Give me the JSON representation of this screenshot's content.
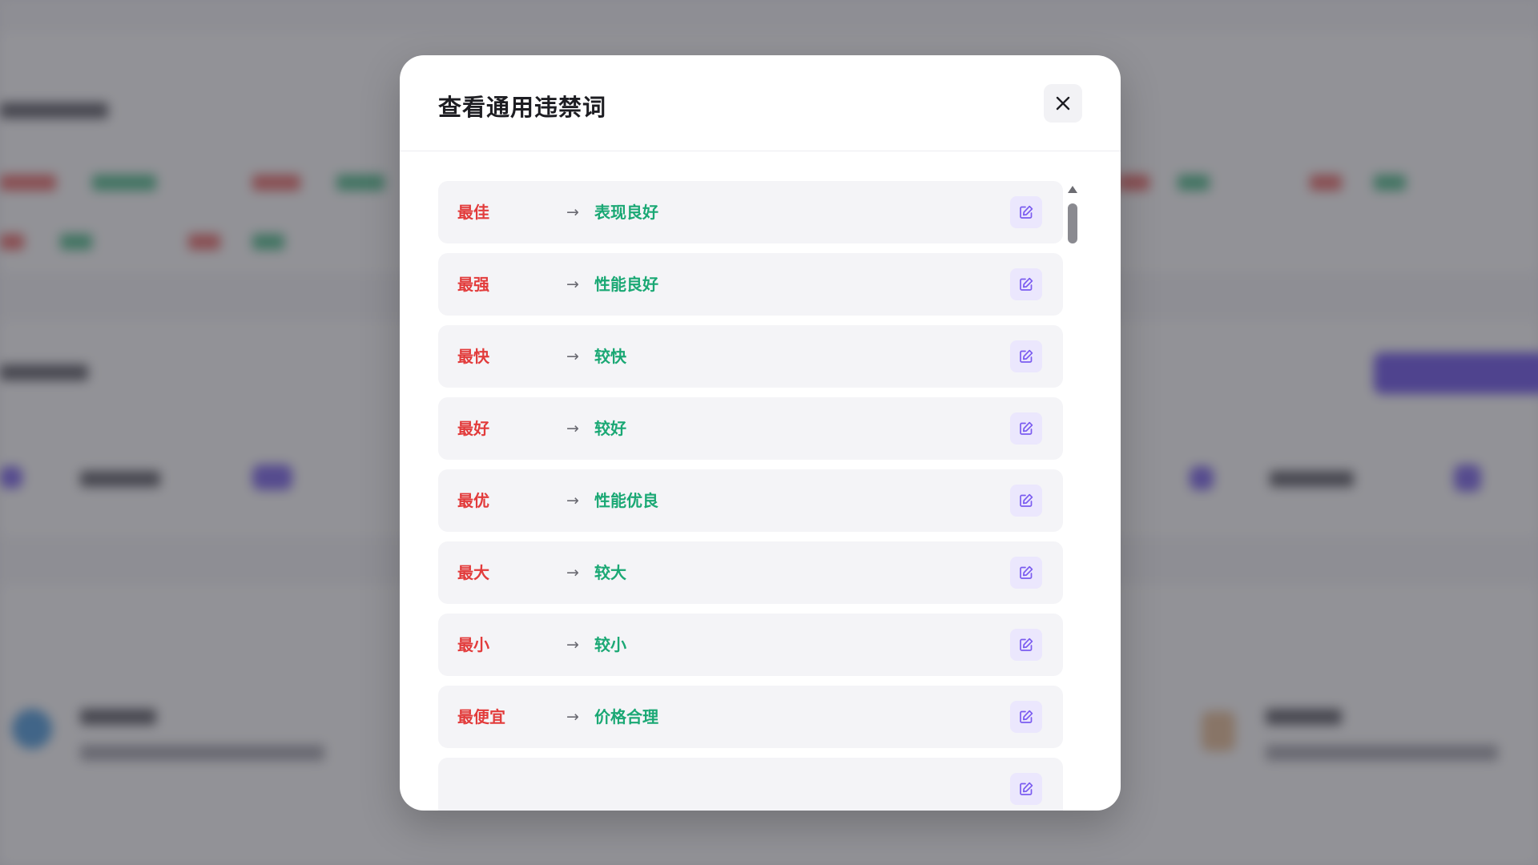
{
  "modal": {
    "title": "查看通用违禁词",
    "close_label": "✕"
  },
  "rules": [
    {
      "from": "最佳",
      "arrow": "→",
      "to": "表现良好"
    },
    {
      "from": "最强",
      "arrow": "→",
      "to": "性能良好"
    },
    {
      "from": "最快",
      "arrow": "→",
      "to": "较快"
    },
    {
      "from": "最好",
      "arrow": "→",
      "to": "较好"
    },
    {
      "from": "最优",
      "arrow": "→",
      "to": "性能优良"
    },
    {
      "from": "最大",
      "arrow": "→",
      "to": "较大"
    },
    {
      "from": "最小",
      "arrow": "→",
      "to": "较小"
    },
    {
      "from": "最便宜",
      "arrow": "→",
      "to": "价格合理"
    }
  ],
  "icons": {
    "close": "close-icon",
    "edit": "edit-icon",
    "scroll_up": "arrow-up-icon",
    "scroll_down": "arrow-down-icon"
  },
  "colors": {
    "forbidden_word": "#e23b3b",
    "replacement_word": "#1aa874",
    "edit_button_bg": "#ebe7fd",
    "edit_icon": "#7b5cf0",
    "accent_background_button": "#5b3fe8"
  }
}
